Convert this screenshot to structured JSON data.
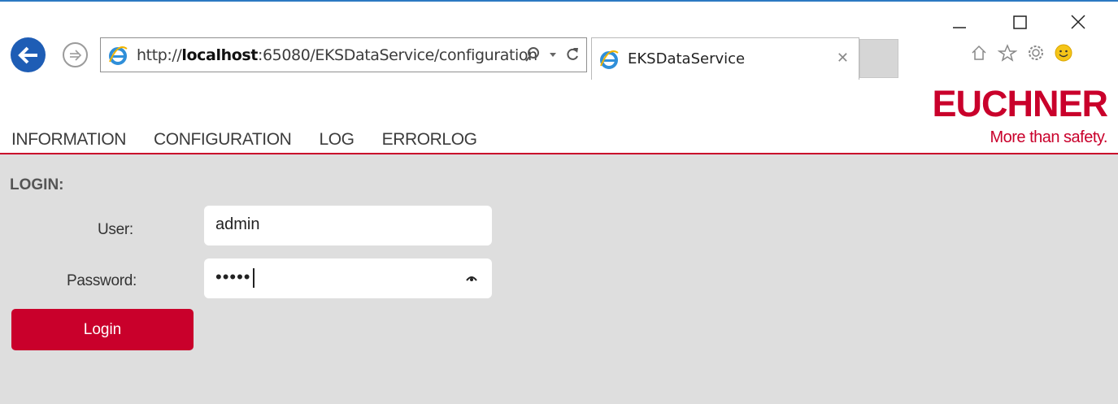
{
  "browser": {
    "url_prefix": "http://",
    "url_host": "localhost",
    "url_rest": ":65080/EKSDataService/configuration",
    "tab_title": "EKSDataService",
    "search_icon": "search-icon",
    "refresh_icon": "refresh-icon",
    "accent": "#2b79c2"
  },
  "brand": {
    "name": "EUCHNER",
    "slogan": "More than safety.",
    "color": "#c9002b"
  },
  "nav": {
    "items": [
      "INFORMATION",
      "CONFIGURATION",
      "LOG",
      "ERRORLOG"
    ]
  },
  "login": {
    "heading": "LOGIN:",
    "user_label": "User:",
    "user_value": "admin",
    "password_label": "Password:",
    "password_value": "•••••",
    "button_label": "Login"
  }
}
